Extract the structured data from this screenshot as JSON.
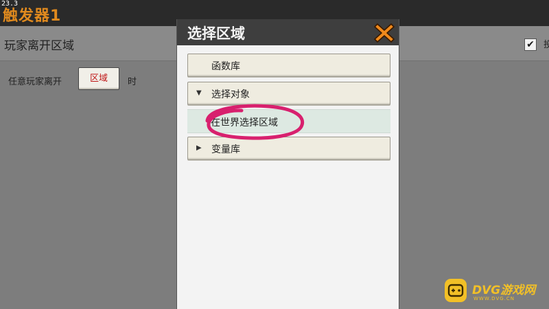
{
  "fps": "23.3",
  "app": {
    "title": "触发器1"
  },
  "header": {
    "title": "玩家离开区域",
    "checkbox_checked": true,
    "checkbox_label": "投"
  },
  "condition": {
    "prefix": "任意玩家离开",
    "button_label": "区域",
    "suffix": "时"
  },
  "dialog": {
    "title": "选择区域",
    "items": [
      {
        "label": "函数库",
        "arrow": ""
      },
      {
        "label": "选择对象",
        "arrow": "▼"
      },
      {
        "label": "在世界选择区域",
        "arrow": ""
      },
      {
        "label": "变量库",
        "arrow": "▶"
      }
    ]
  },
  "watermark": {
    "text": "DVG游戏网",
    "sub": "WWW.DVG.CN"
  },
  "colors": {
    "accent_title": "#e08a1e",
    "button_text": "#c01818",
    "annotation": "#d8206e",
    "watermark": "#f2c027"
  }
}
